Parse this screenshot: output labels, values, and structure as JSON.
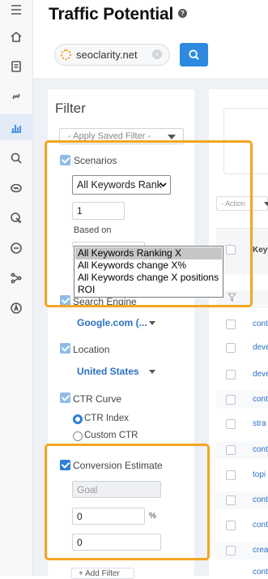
{
  "page": {
    "title": "Traffic Potential",
    "help_glyph": "?"
  },
  "search": {
    "domain": "seoclarity.net",
    "clear_glyph": "×"
  },
  "filter": {
    "title": "Filter",
    "saved_filter_placeholder": "- Apply Saved Filter -",
    "scenarios": {
      "label": "Scenarios",
      "select_value": "All Keywords Rank",
      "number_value": "1",
      "based_on_label": "Based on",
      "options": [
        "All Keywords Ranking X",
        "All Keywords change X%",
        "All Keywords change X positions",
        "ROI"
      ],
      "selected_option": "All Keywords Ranking X"
    },
    "search_engine": {
      "label": "Search Engine",
      "value": "Google.com (..."
    },
    "location": {
      "label": "Location",
      "value": "United States"
    },
    "ctr_curve": {
      "label": "CTR Curve",
      "options": [
        "CTR Index",
        "Custom CTR"
      ],
      "selected": "CTR Index"
    },
    "conversion": {
      "label": "Conversion Estimate",
      "goal_placeholder": "Goal",
      "rate_value": "0",
      "rate_unit": "%",
      "value_value": "0"
    },
    "add_filter_label": "+ Add Filter"
  },
  "table": {
    "action_placeholder": "- Action",
    "column_header_fragment": "Keyw",
    "rows": [
      "cont",
      "deve",
      "deve",
      "cont",
      "stra",
      "cont",
      "topi",
      "cont",
      "cont",
      "crea",
      "cont"
    ]
  },
  "colors": {
    "accent": "#2d8ae0",
    "highlight": "#f4a521",
    "link": "#2b6fc4"
  }
}
